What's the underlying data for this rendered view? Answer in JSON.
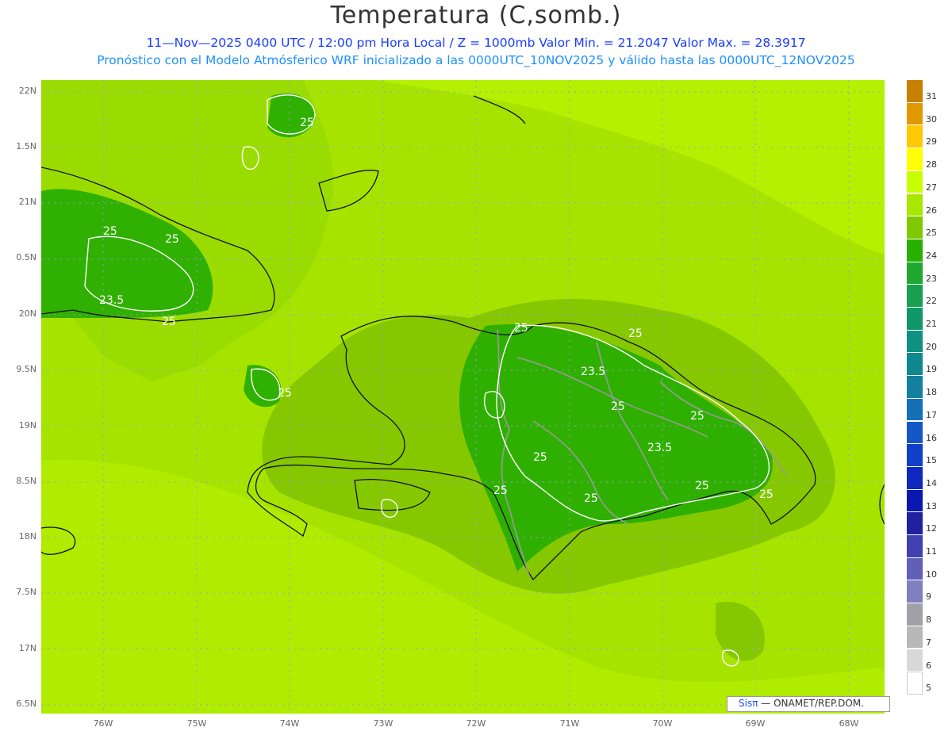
{
  "title": "Temperatura (C,somb.)",
  "subtitle_line1": "11—Nov—2025 0400 UTC / 12:00 pm Hora Local / Z = 1000mb   Valor Min. = 21.2047   Valor Max. = 28.3917",
  "subtitle_line2": "Pronóstico con el Modelo Atmósferico WRF inicializado a las 0000UTC_10NOV2025 y válido hasta las  0000UTC_12NOV2025",
  "lat_labels": [
    "22N",
    "1.5N",
    "21N",
    "0.5N",
    "20N",
    "9.5N",
    "19N",
    "8.5N",
    "18N",
    "7.5N",
    "17N",
    "6.5N"
  ],
  "lon_labels": [
    "76W",
    "75W",
    "74W",
    "73W",
    "72W",
    "71W",
    "70W",
    "69W",
    "68W"
  ],
  "colorbar": {
    "labels": [
      "31",
      "30",
      "29",
      "28",
      "27",
      "26",
      "25",
      "24",
      "23",
      "22",
      "21",
      "20",
      "19",
      "18",
      "17",
      "16",
      "15",
      "14",
      "13",
      "12",
      "11",
      "10",
      "9",
      "8",
      "7",
      "6",
      "5"
    ],
    "colors": [
      "#c88000",
      "#e09a00",
      "#ffc800",
      "#ffff00",
      "#c8ff00",
      "#a8e800",
      "#80c800",
      "#28b000",
      "#20a830",
      "#18a050",
      "#10986a",
      "#109080",
      "#108890",
      "#1480a0",
      "#1670b8",
      "#1458c8",
      "#1040c8",
      "#1028c0",
      "#0818b0",
      "#2020a0",
      "#4040b0",
      "#6060b8",
      "#8080c0",
      "#a0a0a8",
      "#b8b8b8",
      "#d8d8d8",
      "#ffffff"
    ]
  },
  "contour_labels": [
    {
      "text": "25"
    },
    {
      "text": "25"
    },
    {
      "text": "25"
    },
    {
      "text": "23.5"
    },
    {
      "text": "25"
    },
    {
      "text": "25"
    },
    {
      "text": "25"
    },
    {
      "text": "25"
    },
    {
      "text": "23.5"
    },
    {
      "text": "25"
    },
    {
      "text": "25"
    },
    {
      "text": "23.5"
    },
    {
      "text": "25"
    },
    {
      "text": "25"
    },
    {
      "text": "25"
    },
    {
      "text": "25"
    },
    {
      "text": "25"
    }
  ],
  "logo": {
    "sis": "Sisπ",
    "rest": "— ONAMET/REP.DOM."
  }
}
